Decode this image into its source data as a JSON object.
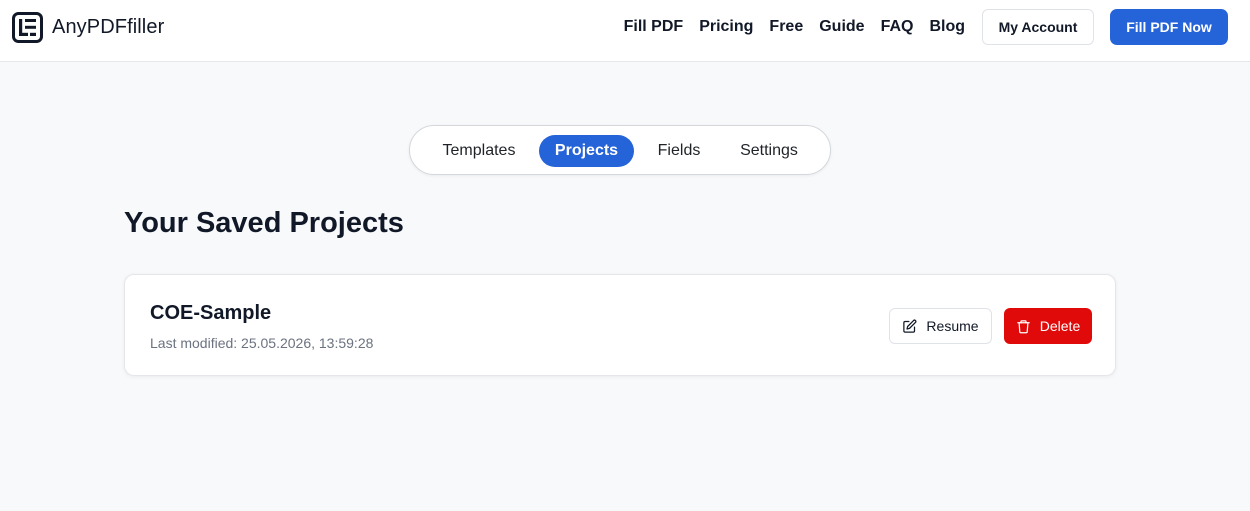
{
  "header": {
    "logo_text": "AnyPDFfiller",
    "nav": [
      "Fill PDF",
      "Pricing",
      "Free",
      "Guide",
      "FAQ",
      "Blog"
    ],
    "account_label": "My Account",
    "cta_label": "Fill PDF Now"
  },
  "tabs": {
    "items": [
      "Templates",
      "Projects",
      "Fields",
      "Settings"
    ],
    "active": "Projects"
  },
  "main": {
    "title": "Your Saved Projects",
    "projects": [
      {
        "name": "COE-Sample",
        "modified": "Last modified: 25.05.2026, 13:59:28",
        "resume_label": "Resume",
        "delete_label": "Delete"
      }
    ]
  },
  "icons": {
    "logo": "logo-document-icon",
    "resume": "edit-pencil-icon",
    "delete": "trash-icon"
  },
  "colors": {
    "accent": "#2563d9",
    "danger": "#e00a0a",
    "background": "#f8f9fb",
    "text": "#111827",
    "muted": "#6b7280"
  }
}
